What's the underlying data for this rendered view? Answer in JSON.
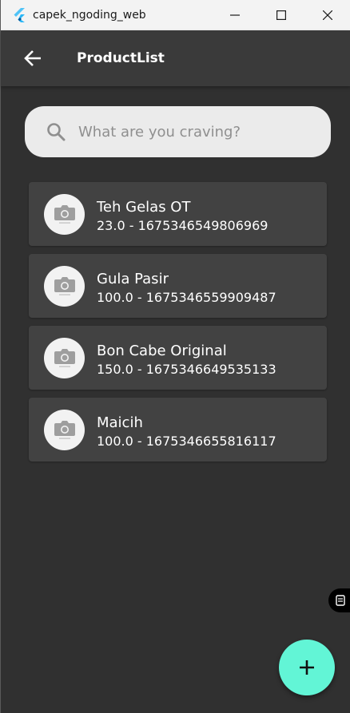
{
  "window": {
    "title": "capek_ngoding_web"
  },
  "appbar": {
    "title": "ProductList"
  },
  "search": {
    "placeholder": "What are you craving?"
  },
  "products": [
    {
      "name": "Teh Gelas OT",
      "subtitle": "23.0 - 1675346549806969"
    },
    {
      "name": "Gula Pasir",
      "subtitle": "100.0 - 1675346559909487"
    },
    {
      "name": "Bon Cabe Original",
      "subtitle": "150.0 - 1675346649535133"
    },
    {
      "name": "Maicih",
      "subtitle": "100.0 - 1675346655816117"
    }
  ],
  "colors": {
    "background": "#303030",
    "appbar": "#3a3a3a",
    "card": "#424242",
    "fab": "#62f5d6"
  },
  "icons": {
    "app": "flutter-icon",
    "back": "arrow-left-icon",
    "search": "search-icon",
    "avatar": "camera-icon",
    "fab": "plus-icon",
    "badge": "device-icon"
  }
}
